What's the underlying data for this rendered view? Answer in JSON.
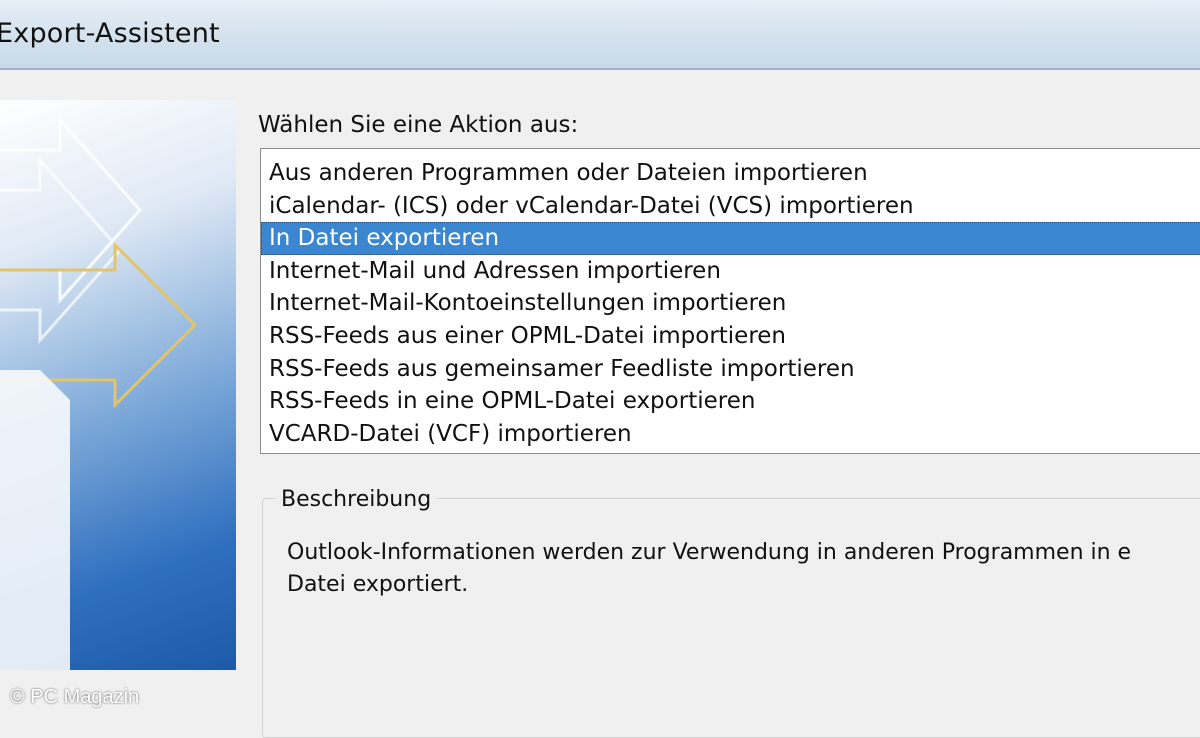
{
  "window": {
    "title": "Export-Assistent"
  },
  "main": {
    "prompt": "Wählen Sie eine Aktion aus:",
    "actions": [
      "Aus anderen Programmen oder Dateien importieren",
      "iCalendar- (ICS) oder vCalendar-Datei (VCS) importieren",
      "In Datei exportieren",
      "Internet-Mail und Adressen importieren",
      "Internet-Mail-Kontoeinstellungen importieren",
      "RSS-Feeds aus einer OPML-Datei importieren",
      "RSS-Feeds aus gemeinsamer Feedliste importieren",
      "RSS-Feeds in eine OPML-Datei exportieren",
      "VCARD-Datei (VCF) importieren"
    ],
    "selected_action": "In Datei exportieren",
    "description": {
      "legend": "Beschreibung",
      "text": "Outlook-Informationen werden zur Verwendung in anderen Programmen in e\nDatei exportiert."
    }
  },
  "watermark": "© PC Magazin",
  "colors": {
    "selection": "#3b86d1",
    "banner_dark": "#1d5aa8",
    "arrow_gold": "#e3c46a"
  }
}
